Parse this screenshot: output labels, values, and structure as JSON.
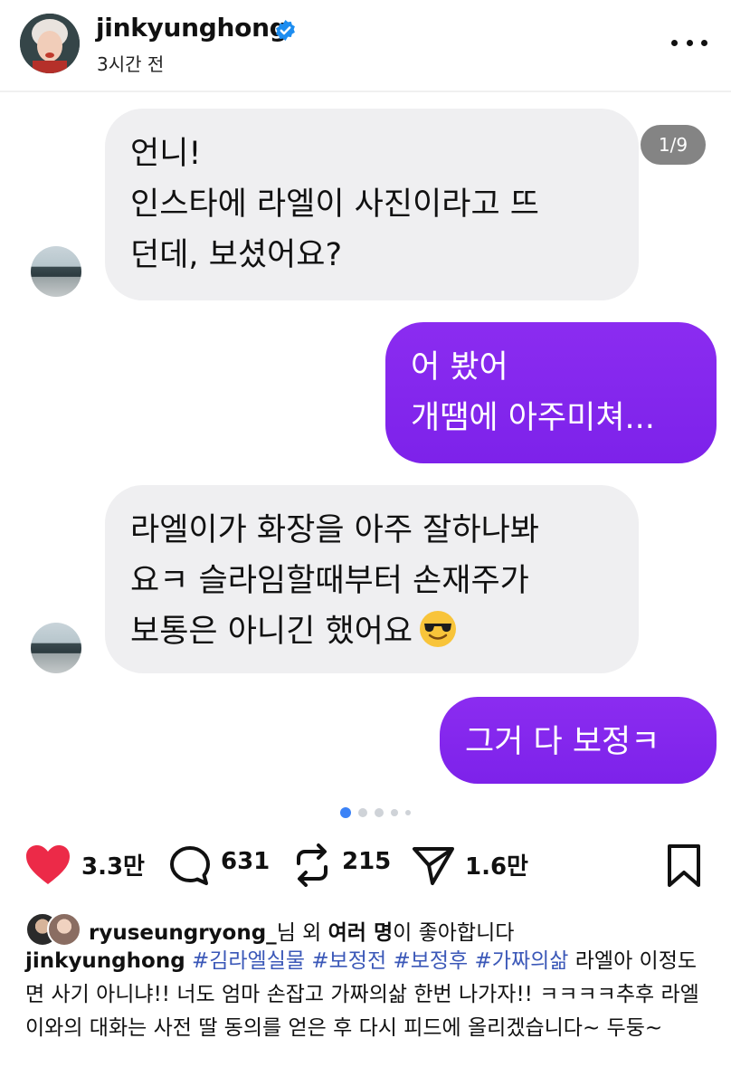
{
  "post": {
    "username": "jinkyunghong",
    "timestamp": "3시간 전",
    "verified": true,
    "icons": [
      "verified-badge-icon",
      "more-options-icon"
    ]
  },
  "carousel": {
    "counter": "1/9",
    "total_dots": 5,
    "active_dot": 1
  },
  "chat": {
    "messages": [
      {
        "side": "left",
        "text": "언니!\n인스타에 라엘이 사진이라고 뜨\n던데, 보셨어요?"
      },
      {
        "side": "right",
        "text": "어 봤어\n개땜에 아주미쳐..."
      },
      {
        "side": "left",
        "text": "라엘이가 화장을 아주 잘하나봐\n요ㅋ 슬라임할때부터 손재주가\n보통은 아니긴 했어요",
        "emoji": "sunglasses-emoji-icon"
      },
      {
        "side": "right",
        "text": "그거 다 보정ㅋ"
      }
    ]
  },
  "actions": {
    "likes": "3.3만",
    "comments": "631",
    "reposts": "215",
    "shares": "1.6만",
    "colors": {
      "heart": "#ec2a48"
    }
  },
  "likes_row": {
    "user": "ryuseungryong_",
    "suffix1": "님 외 ",
    "bold": "여러 명",
    "suffix2": "이 좋아합니다"
  },
  "caption": {
    "username": "jinkyunghong",
    "tags": [
      "#김라엘실물",
      "#보정전",
      "#보정후",
      "#가짜의삶"
    ],
    "text": "라엘아 이정도면 사기 아니냐!! 너도 엄마 손잡고 가짜의삶 한번 나가자!! ㅋㅋㅋㅋ추후 라엘이와의 대화는 사전 딸 동의를 얻은 후 다시 피드에 올리겠습니다~ 두둥~"
  },
  "colors": {
    "accent_purple": "#8b2cf0",
    "tag_blue": "#3b58b8",
    "verified_blue": "#1d8df0"
  }
}
